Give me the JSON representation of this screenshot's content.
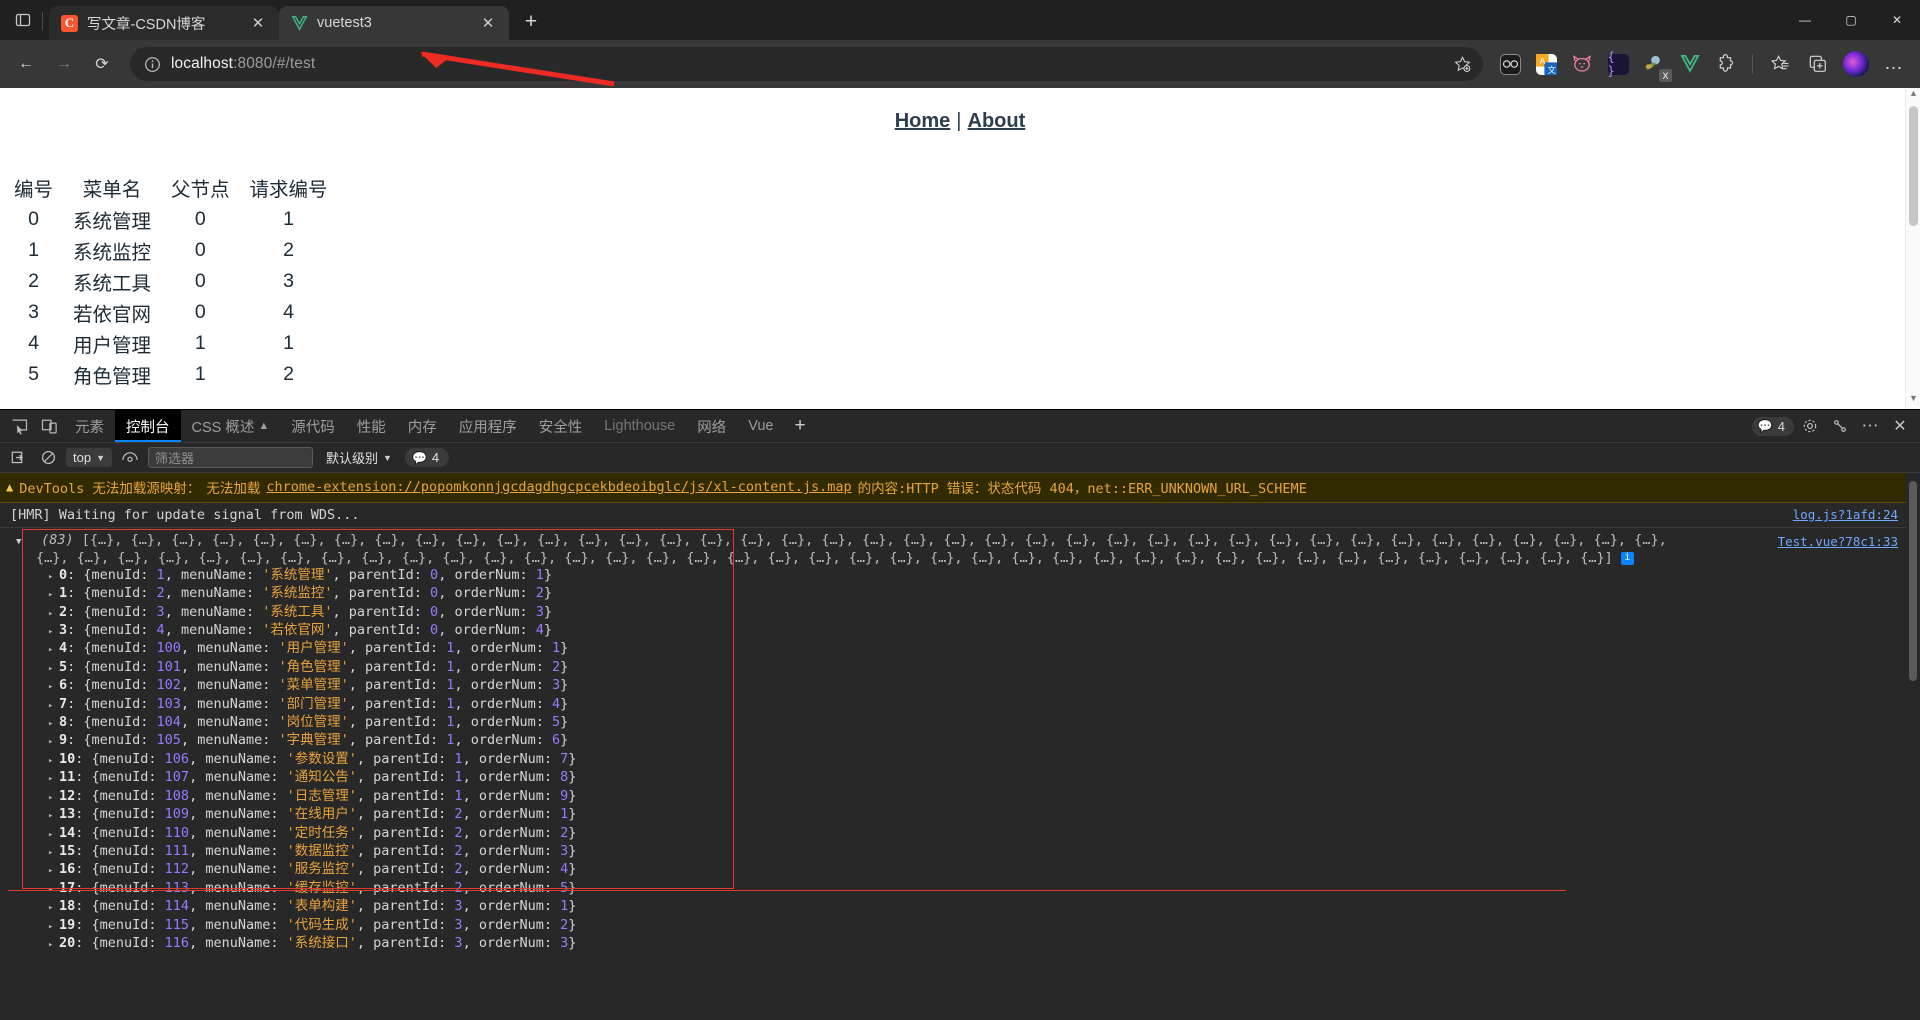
{
  "browser": {
    "tabs": [
      {
        "title": "写文章-CSDN博客",
        "favicon": "csdn-icon",
        "favicon_letter": "C",
        "active": false,
        "close_label": "✕"
      },
      {
        "title": "vuetest3",
        "favicon": "vue-icon",
        "favicon_letter": "V",
        "active": true,
        "close_label": "✕"
      }
    ],
    "new_tab_label": "+",
    "tab_shelf_icon": "tab-list-icon",
    "window_controls": {
      "minimize": "—",
      "maximize": "▢",
      "close": "✕"
    },
    "nav": {
      "back": "←",
      "forward": "→",
      "reload": "⟳",
      "info_icon": "info-circle-icon",
      "url_host": "localhost",
      "url_rest": ":8080/#/test",
      "url_full": "localhost:8080/#/test",
      "star_icon": "add-favorite-icon"
    },
    "extensions": [
      {
        "name": "oo-extension-icon",
        "glyph": "oo"
      },
      {
        "name": "translate-extension-icon",
        "glyph": "A文"
      },
      {
        "name": "cat-extension-icon",
        "glyph": "cat"
      },
      {
        "name": "json-viewer-extension-icon",
        "glyph": "{ }"
      },
      {
        "name": "xmind-extension-icon",
        "glyph": "X"
      },
      {
        "name": "vue-devtools-extension-icon",
        "glyph": "V"
      },
      {
        "name": "puzzle-extensions-icon",
        "glyph": "puzzle"
      }
    ],
    "toolbar_right": {
      "collections_icon": "collections-icon",
      "favorites_icon": "favorites-icon",
      "profile_icon": "profile-avatar",
      "settings_more": "…"
    },
    "annotation": {
      "type": "red-arrow",
      "points_to": "address-bar"
    }
  },
  "page": {
    "nav_links": [
      {
        "label": "Home",
        "href": "#/"
      },
      {
        "label": "About",
        "href": "#/about"
      }
    ],
    "nav_separator": "|",
    "table": {
      "headers": [
        "编号",
        "菜单名",
        "父节点",
        "请求编号"
      ],
      "rows": [
        [
          "0",
          "系统管理",
          "0",
          "1"
        ],
        [
          "1",
          "系统监控",
          "0",
          "2"
        ],
        [
          "2",
          "系统工具",
          "0",
          "3"
        ],
        [
          "3",
          "若依官网",
          "0",
          "4"
        ],
        [
          "4",
          "用户管理",
          "1",
          "1"
        ],
        [
          "5",
          "角色管理",
          "1",
          "2"
        ]
      ]
    }
  },
  "devtools": {
    "left_icons": [
      "inspect-element-icon",
      "device-toolbar-icon"
    ],
    "tabs": [
      {
        "label": "元素",
        "selected": false
      },
      {
        "label": "控制台",
        "selected": true
      },
      {
        "label": "CSS 概述",
        "selected": false,
        "suffix": "▲"
      },
      {
        "label": "源代码",
        "selected": false
      },
      {
        "label": "性能",
        "selected": false
      },
      {
        "label": "内存",
        "selected": false
      },
      {
        "label": "应用程序",
        "selected": false
      },
      {
        "label": "安全性",
        "selected": false
      },
      {
        "label": "Lighthouse",
        "selected": false,
        "muted": true
      },
      {
        "label": "网络",
        "selected": false
      },
      {
        "label": "Vue",
        "selected": false
      }
    ],
    "add_tab_label": "+",
    "issues_count": "4",
    "right_icons": [
      "settings-gear-icon",
      "devtools-customize-icon",
      "more-options-icon",
      "close-devtools-icon"
    ],
    "console_toolbar": {
      "clear_console_icon": "clear-console-icon",
      "no_entry_icon": "no-entry-icon",
      "context_value": "top",
      "eye_icon": "live-expression-icon",
      "filter_placeholder": "筛选器",
      "filter_value": "",
      "level_value": "默认级别",
      "message_count": "4"
    },
    "warning": {
      "icon": "warning-triangle-icon",
      "prefix": "DevTools 无法加载源映射：",
      "middle": "无法加载",
      "link": "chrome-extension://popomkonnjgcdagdhgcpcekbdeoibglc/js/xl-content.js.map",
      "suffix": "的内容:HTTP 错误：状态代码 404，net::ERR_UNKNOWN_URL_SCHEME"
    },
    "log_hmr": {
      "text": "[HMR] Waiting for update signal from WDS...",
      "source": "log.js?1afd:24"
    },
    "array_log": {
      "source": "Test.vue?78c1:33",
      "count_label": "(83)",
      "preview_row1": "[{…}, {…}, {…}, {…}, {…}, {…}, {…}, {…}, {…}, {…}, {…}, {…}, {…}, {…}, {…}, {…}, {…}, {…}, {…}, {…}, {…}, {…}, {…}, {…}, {…}, {…}, {…}, {…}, {…}, {…}, {…}, {…}, {…}, {…}, {…}, {…}, {…}, {…}, {…},",
      "preview_row2": "{…}, {…}, {…}, {…}, {…}, {…}, {…}, {…}, {…}, {…}, {…}, {…}, {…}, {…}, {…}, {…}, {…}, {…}, {…}, {…}, {…}, {…}, {…}, {…}, {…}, {…}, {…}, {…}, {…}, {…}, {…}, {…}, {…}, {…}, {…}, {…}, {…}, {…}, {…}]",
      "items": [
        {
          "index": "0",
          "menuId": "1",
          "menuName": "系统管理",
          "parentId": "0",
          "orderNum": "1"
        },
        {
          "index": "1",
          "menuId": "2",
          "menuName": "系统监控",
          "parentId": "0",
          "orderNum": "2"
        },
        {
          "index": "2",
          "menuId": "3",
          "menuName": "系统工具",
          "parentId": "0",
          "orderNum": "3"
        },
        {
          "index": "3",
          "menuId": "4",
          "menuName": "若依官网",
          "parentId": "0",
          "orderNum": "4"
        },
        {
          "index": "4",
          "menuId": "100",
          "menuName": "用户管理",
          "parentId": "1",
          "orderNum": "1"
        },
        {
          "index": "5",
          "menuId": "101",
          "menuName": "角色管理",
          "parentId": "1",
          "orderNum": "2"
        },
        {
          "index": "6",
          "menuId": "102",
          "menuName": "菜单管理",
          "parentId": "1",
          "orderNum": "3"
        },
        {
          "index": "7",
          "menuId": "103",
          "menuName": "部门管理",
          "parentId": "1",
          "orderNum": "4"
        },
        {
          "index": "8",
          "menuId": "104",
          "menuName": "岗位管理",
          "parentId": "1",
          "orderNum": "5"
        },
        {
          "index": "9",
          "menuId": "105",
          "menuName": "字典管理",
          "parentId": "1",
          "orderNum": "6"
        },
        {
          "index": "10",
          "menuId": "106",
          "menuName": "参数设置",
          "parentId": "1",
          "orderNum": "7"
        },
        {
          "index": "11",
          "menuId": "107",
          "menuName": "通知公告",
          "parentId": "1",
          "orderNum": "8"
        },
        {
          "index": "12",
          "menuId": "108",
          "menuName": "日志管理",
          "parentId": "1",
          "orderNum": "9"
        },
        {
          "index": "13",
          "menuId": "109",
          "menuName": "在线用户",
          "parentId": "2",
          "orderNum": "1"
        },
        {
          "index": "14",
          "menuId": "110",
          "menuName": "定时任务",
          "parentId": "2",
          "orderNum": "2"
        },
        {
          "index": "15",
          "menuId": "111",
          "menuName": "数据监控",
          "parentId": "2",
          "orderNum": "3"
        },
        {
          "index": "16",
          "menuId": "112",
          "menuName": "服务监控",
          "parentId": "2",
          "orderNum": "4"
        },
        {
          "index": "17",
          "menuId": "113",
          "menuName": "缓存监控",
          "parentId": "2",
          "orderNum": "5"
        },
        {
          "index": "18",
          "menuId": "114",
          "menuName": "表单构建",
          "parentId": "3",
          "orderNum": "1"
        },
        {
          "index": "19",
          "menuId": "115",
          "menuName": "代码生成",
          "parentId": "3",
          "orderNum": "2"
        },
        {
          "index": "20",
          "menuId": "116",
          "menuName": "系统接口",
          "parentId": "3",
          "orderNum": "3"
        }
      ]
    }
  },
  "colors": {
    "accent_blue": "#0b84ff",
    "warning_bg": "#332b00",
    "warning_fg": "#e8a33d",
    "annotation_red": "#e03a2f",
    "vue_green": "#41b883",
    "csdn_orange": "#fc5531"
  }
}
